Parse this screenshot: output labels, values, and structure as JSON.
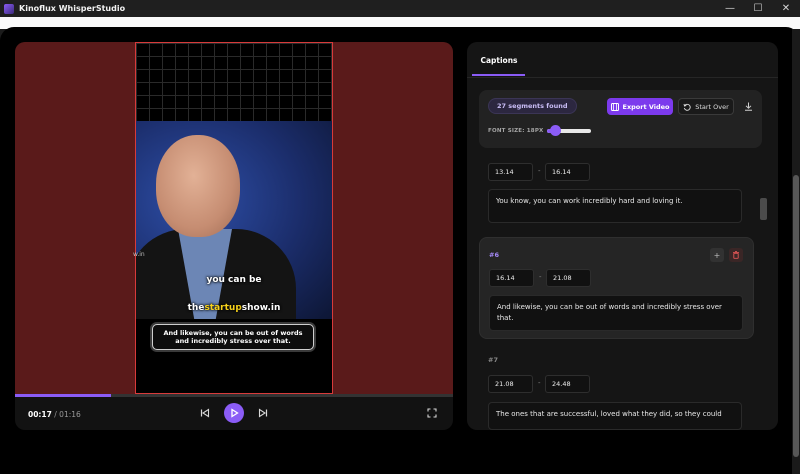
{
  "window": {
    "title": "Kinoflux WhisperStudio",
    "minimize": "—",
    "maximize": "☐",
    "close": "✕"
  },
  "video": {
    "overlay_line1": "you can be",
    "overlay_the": "the",
    "overlay_startup": "startup",
    "overlay_show": "show.in",
    "side_mark": "w.in",
    "caption": "And likewise, you can be out of words and incredibly stress over that.",
    "progress_percent": 22,
    "current_time": "00:17",
    "separator": " / ",
    "total_time": "01:16"
  },
  "captions_panel": {
    "tab_label": "Captions",
    "segments_badge": "27 segments found",
    "export_label": "Export Video",
    "start_over_label": "Start Over",
    "font_size_label": "FONT SIZE: 18PX",
    "font_size_percent": 18,
    "segments": [
      {
        "number": "",
        "start": "13.14",
        "end": "16.14",
        "text": "You know, you can work incredibly hard and loving it."
      },
      {
        "number": "#6",
        "start": "16.14",
        "end": "21.08",
        "text": "And likewise, you can be out of words and incredibly stress over that."
      },
      {
        "number": "#7",
        "start": "21.08",
        "end": "24.48",
        "text": "The ones that are successful, loved what they did, so they could"
      }
    ]
  },
  "colors": {
    "accent": "#8b5cf6",
    "export_button": "#7c3aed",
    "video_background": "#5a1a1a",
    "frame_border": "#d83a3a",
    "overlay_highlight": "#f7d21b"
  }
}
